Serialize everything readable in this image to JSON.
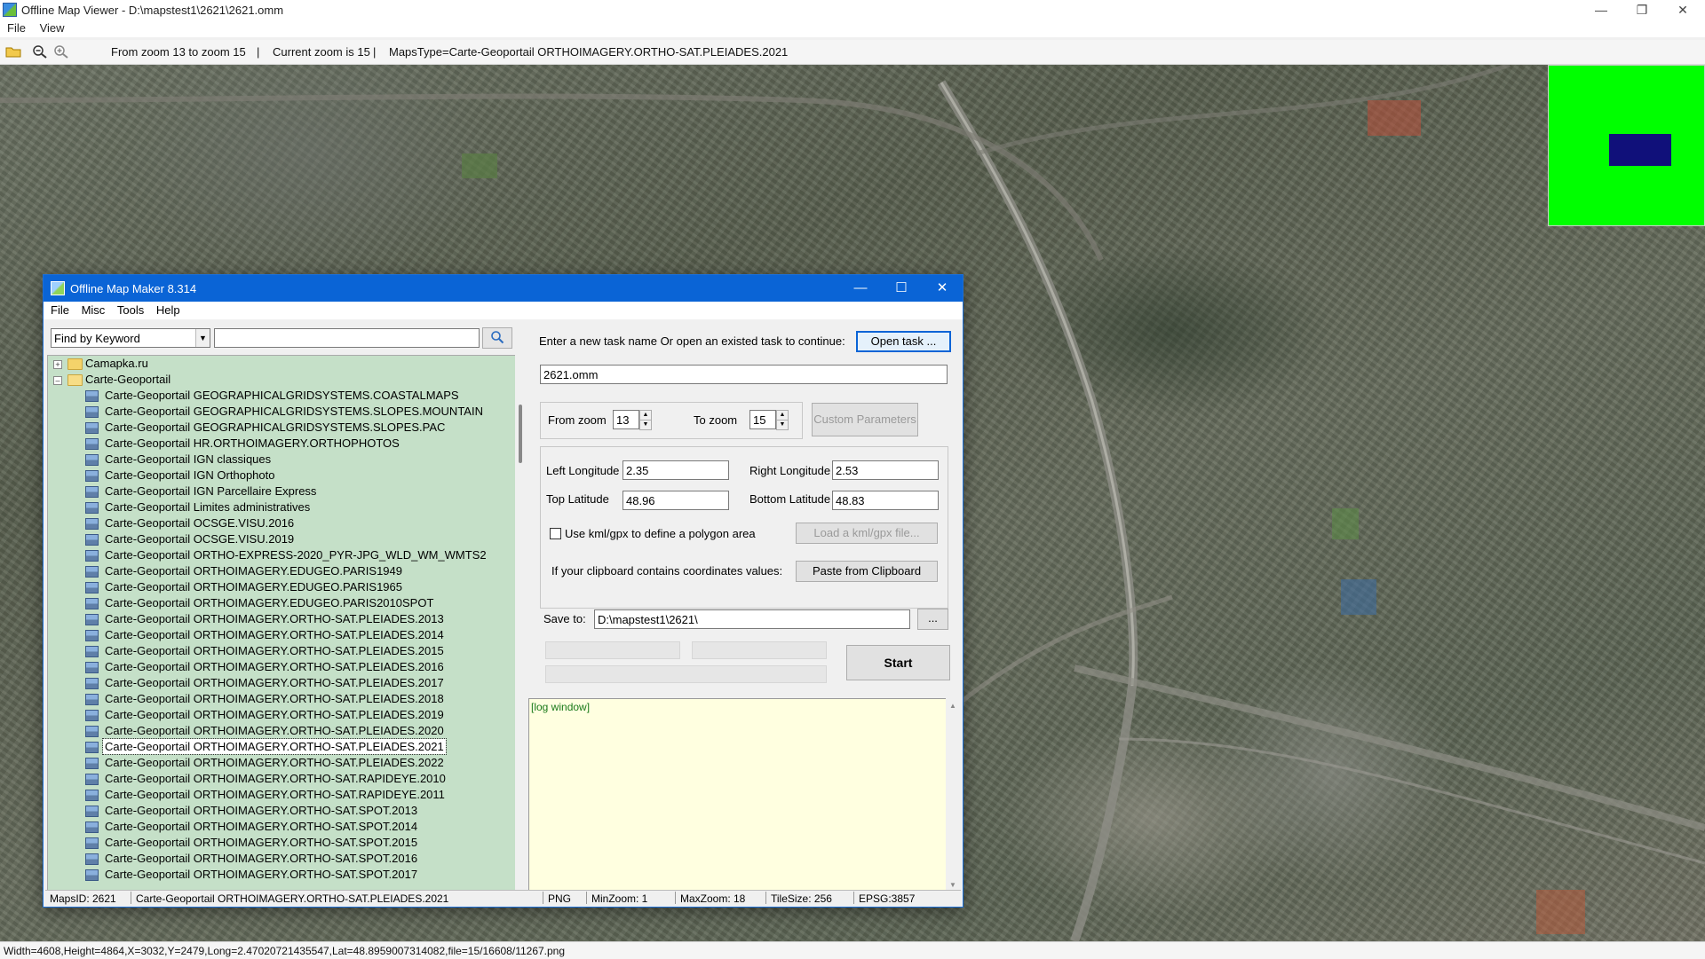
{
  "viewer": {
    "title": "Offline Map Viewer - D:\\mapstest1\\2621\\2621.omm",
    "menu": [
      "File",
      "View"
    ],
    "toolbar": {
      "zoom_range": "From zoom 13 to zoom 15",
      "sep1": "|",
      "current_zoom": "Current zoom is 15",
      "sep2": "|",
      "maps_type": "MapsType=Carte-Geoportail ORTHOIMAGERY.ORTHO-SAT.PLEIADES.2021"
    },
    "status": "Width=4608,Height=4864,X=3032,Y=2479,Long=2.47020721435547,Lat=48.8959007314082,file=15/16608/11267.png",
    "minimap_color": "#00ff00",
    "viewport_color": "#10107a"
  },
  "dialog": {
    "title": "Offline Map Maker 8.314",
    "menu": [
      "File",
      "Misc",
      "Tools",
      "Help"
    ],
    "search": {
      "mode": "Find by Keyword",
      "query": ""
    },
    "tree": {
      "folders": [
        "Camapka.ru",
        "Carte-Geoportail"
      ],
      "items": [
        "Carte-Geoportail GEOGRAPHICALGRIDSYSTEMS.COASTALMAPS",
        "Carte-Geoportail GEOGRAPHICALGRIDSYSTEMS.SLOPES.MOUNTAIN",
        "Carte-Geoportail GEOGRAPHICALGRIDSYSTEMS.SLOPES.PAC",
        "Carte-Geoportail HR.ORTHOIMAGERY.ORTHOPHOTOS",
        "Carte-Geoportail IGN classiques",
        "Carte-Geoportail IGN Orthophoto",
        "Carte-Geoportail IGN Parcellaire Express",
        "Carte-Geoportail Limites administratives",
        "Carte-Geoportail OCSGE.VISU.2016",
        "Carte-Geoportail OCSGE.VISU.2019",
        "Carte-Geoportail ORTHO-EXPRESS-2020_PYR-JPG_WLD_WM_WMTS2",
        "Carte-Geoportail ORTHOIMAGERY.EDUGEO.PARIS1949",
        "Carte-Geoportail ORTHOIMAGERY.EDUGEO.PARIS1965",
        "Carte-Geoportail ORTHOIMAGERY.EDUGEO.PARIS2010SPOT",
        "Carte-Geoportail ORTHOIMAGERY.ORTHO-SAT.PLEIADES.2013",
        "Carte-Geoportail ORTHOIMAGERY.ORTHO-SAT.PLEIADES.2014",
        "Carte-Geoportail ORTHOIMAGERY.ORTHO-SAT.PLEIADES.2015",
        "Carte-Geoportail ORTHOIMAGERY.ORTHO-SAT.PLEIADES.2016",
        "Carte-Geoportail ORTHOIMAGERY.ORTHO-SAT.PLEIADES.2017",
        "Carte-Geoportail ORTHOIMAGERY.ORTHO-SAT.PLEIADES.2018",
        "Carte-Geoportail ORTHOIMAGERY.ORTHO-SAT.PLEIADES.2019",
        "Carte-Geoportail ORTHOIMAGERY.ORTHO-SAT.PLEIADES.2020",
        "Carte-Geoportail ORTHOIMAGERY.ORTHO-SAT.PLEIADES.2021",
        "Carte-Geoportail ORTHOIMAGERY.ORTHO-SAT.PLEIADES.2022",
        "Carte-Geoportail ORTHOIMAGERY.ORTHO-SAT.RAPIDEYE.2010",
        "Carte-Geoportail ORTHOIMAGERY.ORTHO-SAT.RAPIDEYE.2011",
        "Carte-Geoportail ORTHOIMAGERY.ORTHO-SAT.SPOT.2013",
        "Carte-Geoportail ORTHOIMAGERY.ORTHO-SAT.SPOT.2014",
        "Carte-Geoportail ORTHOIMAGERY.ORTHO-SAT.SPOT.2015",
        "Carte-Geoportail ORTHOIMAGERY.ORTHO-SAT.SPOT.2016",
        "Carte-Geoportail ORTHOIMAGERY.ORTHO-SAT.SPOT.2017"
      ],
      "selected_index": 22
    },
    "task_prompt": "Enter a new task name Or open an existed task to continue:",
    "open_task_label": "Open task ...",
    "task_name": "2621.omm",
    "from_zoom_label": "From zoom",
    "from_zoom": "13",
    "to_zoom_label": "To zoom",
    "to_zoom": "15",
    "custom_params_label": "Custom Parameters",
    "left_lon_label": "Left Longitude",
    "left_lon": "2.35",
    "right_lon_label": "Right Longitude",
    "right_lon": "2.53",
    "top_lat_label": "Top Latitude",
    "top_lat": "48.96",
    "bottom_lat_label": "Bottom Latitude",
    "bottom_lat": "48.83",
    "kml_check_label": "Use kml/gpx to define a polygon area",
    "load_kml_label": "Load a kml/gpx file...",
    "clipboard_label": "If your clipboard contains coordinates values:",
    "paste_label": "Paste from Clipboard",
    "save_to_label": "Save to:",
    "save_to": "D:\\mapstest1\\2621\\",
    "browse_label": "...",
    "start_label": "Start",
    "log_placeholder": "[log window]",
    "status": {
      "maps_id": "MapsID: 2621",
      "maps_name": "Carte-Geoportail ORTHOIMAGERY.ORTHO-SAT.PLEIADES.2021",
      "format": "PNG",
      "min_zoom": "MinZoom: 1",
      "max_zoom": "MaxZoom: 18",
      "tile_size": "TileSize: 256",
      "epsg": "EPSG:3857"
    }
  }
}
